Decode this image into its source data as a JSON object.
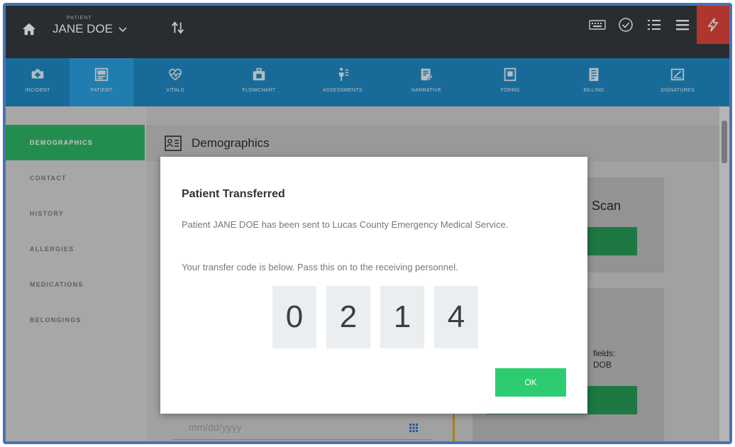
{
  "topbar": {
    "patient_caption": "PATIENT",
    "patient_name": "JANE DOE"
  },
  "nav": {
    "items": [
      {
        "label": "Incident",
        "icon": "ambulance-icon"
      },
      {
        "label": "Patient",
        "icon": "id-card-icon",
        "active": true
      },
      {
        "label": "Vitals",
        "icon": "heartbeat-icon"
      },
      {
        "label": "Flowchart",
        "icon": "medkit-icon"
      },
      {
        "label": "Assessments",
        "icon": "body-icon"
      },
      {
        "label": "Narrative",
        "icon": "document-edit-icon"
      },
      {
        "label": "Forms",
        "icon": "forms-icon"
      },
      {
        "label": "Billing",
        "icon": "billing-icon"
      },
      {
        "label": "Signatures",
        "icon": "signature-icon"
      }
    ]
  },
  "sidebar": {
    "items": [
      {
        "label": "DEMOGRAPHICS",
        "active": true
      },
      {
        "label": "CONTACT"
      },
      {
        "label": "HISTORY"
      },
      {
        "label": "ALLERGIES"
      },
      {
        "label": "MEDICATIONS"
      },
      {
        "label": "BELONGINGS"
      }
    ]
  },
  "content": {
    "section_title": "Demographics",
    "scan_label": "Scan",
    "fields_line1": "fields:",
    "fields_line2": "DOB",
    "date_placeholder": "mm/dd/yyyy"
  },
  "modal": {
    "title": "Patient Transferred",
    "message": "Patient JANE DOE has been sent to Lucas County Emergency Medical Service.",
    "instruction": "Your transfer code is below. Pass this on to the receiving personnel.",
    "code": [
      "0",
      "2",
      "1",
      "4"
    ],
    "ok_label": "OK"
  },
  "colors": {
    "topbar": "#343a40",
    "navbar": "#1f89c4",
    "nav_active": "#2ba1e0",
    "sidebar_active": "#2eb567",
    "ok_button": "#2ecc71",
    "flag_button": "#e0463c"
  }
}
